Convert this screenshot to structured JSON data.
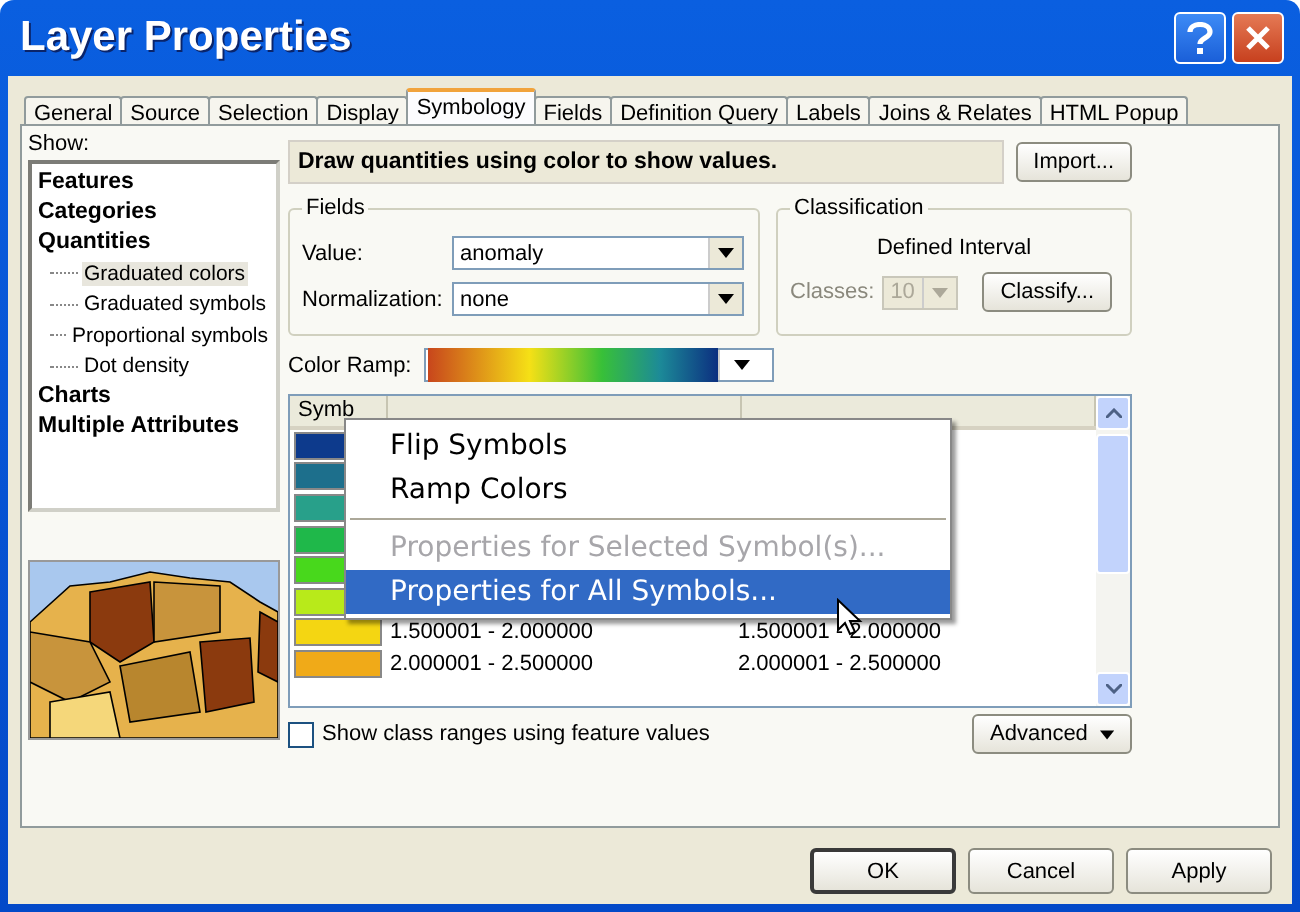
{
  "window": {
    "title": "Layer Properties"
  },
  "tabs": [
    {
      "label": "General",
      "selected": false
    },
    {
      "label": "Source",
      "selected": false
    },
    {
      "label": "Selection",
      "selected": false
    },
    {
      "label": "Display",
      "selected": false
    },
    {
      "label": "Symbology",
      "selected": true
    },
    {
      "label": "Fields",
      "selected": false
    },
    {
      "label": "Definition Query",
      "selected": false
    },
    {
      "label": "Labels",
      "selected": false
    },
    {
      "label": "Joins & Relates",
      "selected": false
    },
    {
      "label": "HTML Popup",
      "selected": false
    }
  ],
  "show": {
    "label": "Show:",
    "items": [
      {
        "label": "Features",
        "selected": false
      },
      {
        "label": "Categories",
        "selected": false
      },
      {
        "label": "Quantities",
        "selected": false,
        "children": [
          {
            "label": "Graduated colors",
            "selected": true
          },
          {
            "label": "Graduated symbols",
            "selected": false
          },
          {
            "label": "Proportional symbols",
            "selected": false
          },
          {
            "label": "Dot density",
            "selected": false
          }
        ]
      },
      {
        "label": "Charts",
        "selected": false
      },
      {
        "label": "Multiple Attributes",
        "selected": false
      }
    ]
  },
  "description": "Draw quantities using color to show values.",
  "import_button": "Import...",
  "fields": {
    "title": "Fields",
    "value_label": "Value:",
    "value": "anomaly",
    "normalization_label": "Normalization:",
    "normalization": "none"
  },
  "classification": {
    "title": "Classification",
    "method": "Defined Interval",
    "classes_label": "Classes:",
    "classes": "10",
    "classes_disabled": true,
    "classify_button": "Classify..."
  },
  "color_ramp": {
    "label": "Color Ramp:"
  },
  "table": {
    "columns": [
      "Symb"
    ],
    "rows": [
      {
        "color": "#0d3a8c"
      },
      {
        "color": "#1d6f8c"
      },
      {
        "color": "#28a08a"
      },
      {
        "color": "#1fb84a"
      },
      {
        "color": "#48d81c"
      },
      {
        "color": "#b8ea1a"
      },
      {
        "color": "#f4d612",
        "range": "1.500001 - 2.000000",
        "label": "1.500001 - 2.000000"
      },
      {
        "color": "#f0aa18",
        "range": "2.000001 - 2.500000",
        "label": "2.000001 - 2.500000"
      }
    ]
  },
  "show_ranges": {
    "label": "Show class ranges using feature values",
    "checked": false
  },
  "advanced_button": "Advanced",
  "context_menu": [
    {
      "kind": "item",
      "label": "Flip Symbols",
      "disabled": false,
      "selected": false
    },
    {
      "kind": "item",
      "label": "Ramp Colors",
      "disabled": false,
      "selected": false
    },
    {
      "kind": "separator"
    },
    {
      "kind": "item",
      "label": "Properties for Selected Symbol(s)...",
      "disabled": true,
      "selected": false
    },
    {
      "kind": "item",
      "label": "Properties for All Symbols...",
      "disabled": false,
      "selected": true
    }
  ],
  "buttons": [
    {
      "label": "OK",
      "default": true
    },
    {
      "label": "Cancel",
      "default": false
    },
    {
      "label": "Apply",
      "default": false
    }
  ]
}
